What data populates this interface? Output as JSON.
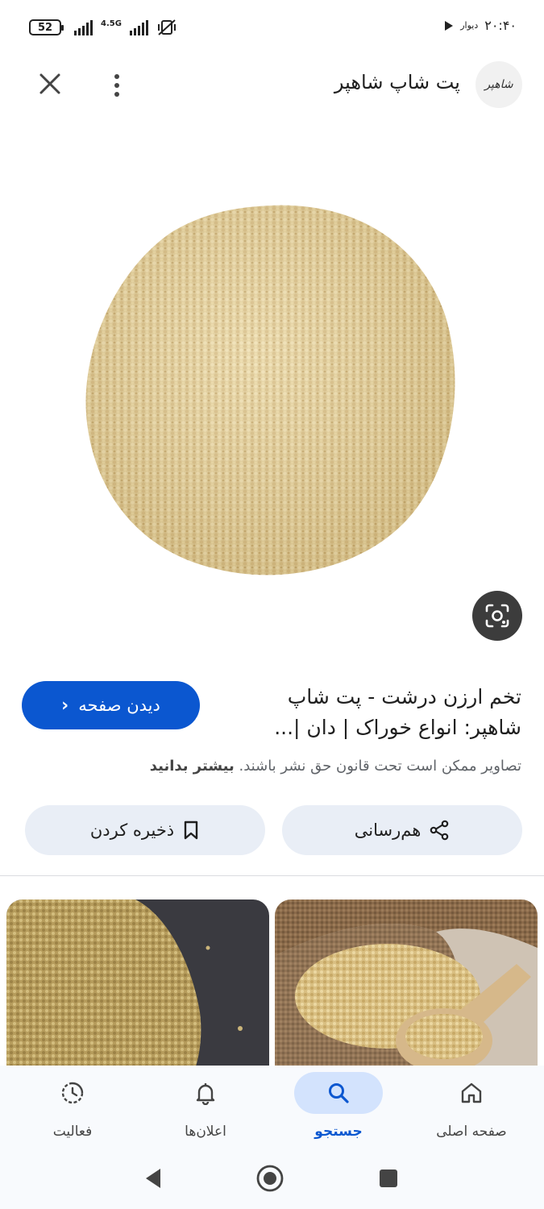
{
  "status_bar": {
    "battery": "52",
    "network": "4.5G",
    "time": "۲۰:۴۰",
    "app_label": "دیوار"
  },
  "header": {
    "site_title": "پت شاپ شاهپر",
    "logo_text": "شاهپر"
  },
  "result": {
    "title": "تخم ارزن درشت - پت شاپ شاهپر: انواع خوراک | دان |...",
    "visit_label": "دیدن صفحه",
    "copyright_text": "تصاویر ممکن است تحت قانون حق نشر باشند.",
    "learn_more": "بیشتر بدانید"
  },
  "actions": {
    "share_label": "هم‌رسانی",
    "save_label": "ذخیره کردن"
  },
  "bottom_nav": {
    "home": "صفحه اصلی",
    "search": "جستجو",
    "notifications": "اعلان‌ها",
    "activity": "فعالیت"
  },
  "colors": {
    "accent": "#0b57d0",
    "active_pill": "#d3e3fd",
    "action_bg": "#e9eef6"
  }
}
